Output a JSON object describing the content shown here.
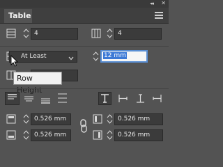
{
  "panel": {
    "title": "Table",
    "rows_value": "4",
    "columns_value": "4",
    "row_height_mode": "At Least",
    "row_height_value": "12 mm",
    "tooltip": "Row Height",
    "inset_top": "0.526 mm",
    "inset_bottom": "0.526 mm",
    "inset_left": "0.526 mm",
    "inset_right": "0.526 mm"
  },
  "colors": {
    "panel_bg": "#535353",
    "field_bg": "#3b3b3b",
    "selection": "#3d7ad6",
    "focus_ring": "#5a8fd4"
  },
  "icons": [
    "collapse-arrows-icon",
    "close-icon",
    "panel-menu-icon",
    "rows-icon",
    "columns-icon",
    "row-height-icon",
    "column-width-icon",
    "spinner-icon",
    "chevron-down-icon",
    "align-top-icon",
    "align-center-icon",
    "align-bottom-icon",
    "justify-vertical-icon",
    "text-rotate-0-icon",
    "text-rotate-90-icon",
    "text-rotate-180-icon",
    "text-rotate-270-icon",
    "inset-top-icon",
    "inset-bottom-icon",
    "inset-left-icon",
    "inset-right-icon",
    "link-icon"
  ]
}
